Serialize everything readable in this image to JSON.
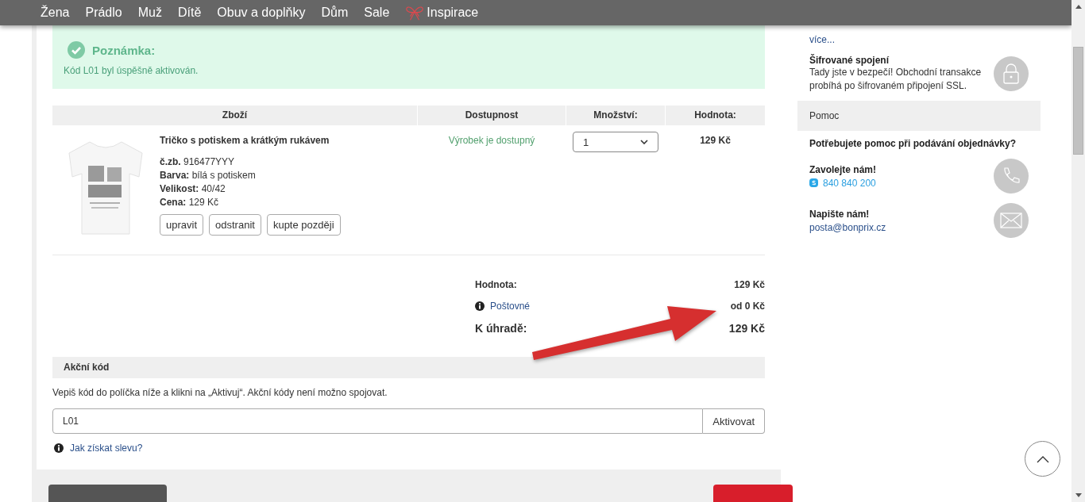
{
  "nav": [
    {
      "label": "Žena",
      "kind": "plain"
    },
    {
      "label": "Prádlo",
      "kind": "plain"
    },
    {
      "label": "Muž",
      "kind": "plain"
    },
    {
      "label": "Dítě",
      "kind": "plain"
    },
    {
      "label": "Obuv a doplňky",
      "kind": "plain"
    },
    {
      "label": "Dům",
      "kind": "plain"
    },
    {
      "label": "Sale",
      "kind": "plain"
    },
    {
      "label": "Inspirace",
      "kind": "featured"
    }
  ],
  "note": {
    "title": "Poznámka:",
    "text": "Kód L01 byl úspěšně aktivován."
  },
  "cart": {
    "columns": [
      "Zboží",
      "Dostupnost",
      "Množství:",
      "Hodnota:"
    ],
    "rows": [
      {
        "name": "Tričko s potiskem a krátkým rukávem",
        "details": [
          {
            "label": "č.zb.",
            "value": "916477YYY"
          },
          {
            "label": "Barva:",
            "value": "bílá s potiskem"
          },
          {
            "label": "Velikost:",
            "value": "40/42"
          },
          {
            "label": "Cena:",
            "value": "129 Kč"
          }
        ],
        "availability": "Výrobek je dostupný",
        "quantity": "1",
        "value": "129 Kč",
        "actions": [
          "upravit",
          "odstranit",
          "kupte později"
        ]
      }
    ]
  },
  "totals": [
    {
      "kind": "plain",
      "label": "Hodnota:",
      "value": "129 Kč"
    },
    {
      "kind": "info",
      "label": "Poštovné",
      "value": "od 0 Kč"
    },
    {
      "kind": "total",
      "label": "K úhradě:",
      "value": "129 Kč"
    }
  ],
  "promo": {
    "title": "Akční kód",
    "hint": "Vepiš kód do políčka níže a klikni na „Aktivuj“. Akční kódy není možno spojovat.",
    "value": "L01",
    "button": "Aktivovat",
    "help_link": "Jak získat slevu?"
  },
  "footer_buttons": [
    {
      "kind": "secondary"
    },
    {
      "kind": "primary"
    }
  ],
  "sidebar": {
    "more_link": "více...",
    "secure": {
      "title": "Šifrované spojení",
      "text": "Tady jste v bezpečí! Obchodní transakce probíhá po šifrovaném připojení SSL."
    },
    "help": {
      "header": "Pomoc",
      "question": "Potřebujete pomoc při podávání objednávky?",
      "call": {
        "title": "Zavolejte nám!",
        "phone": "840 840 200"
      },
      "write": {
        "title": "Napište nám!",
        "email": "posta@bonprix.cz"
      }
    }
  }
}
